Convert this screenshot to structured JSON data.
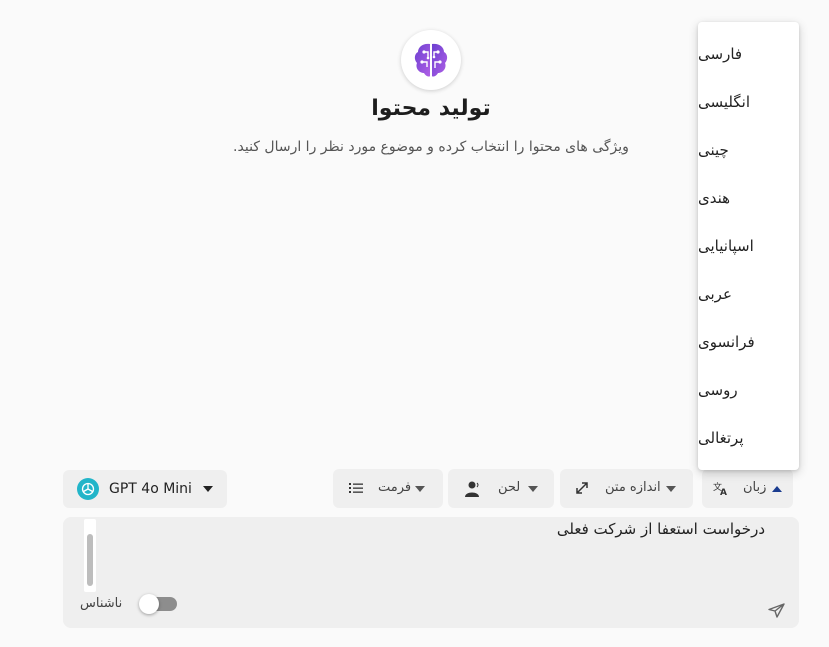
{
  "header": {
    "title": "تولید محتوا",
    "subtitle": "ویژگی های محتوا را انتخاب کرده و موضوع مورد نظر را ارسال کنید."
  },
  "toolbar": {
    "language_label": "زبان",
    "size_label": "اندازه متن",
    "tone_label": "لحن",
    "format_label": "فرمت",
    "model_label": "GPT 4o Mini"
  },
  "input": {
    "value": "درخواست استعفا از شرکت فعلی",
    "anonymous_label": "ناشناس",
    "anonymous_on": false
  },
  "language_menu": {
    "items": [
      "فارسی",
      "انگلیسی",
      "چینی",
      "هندی",
      "اسپانیایی",
      "عربی",
      "فرانسوی",
      "روسی",
      "پرتغالی"
    ]
  },
  "colors": {
    "logo_purple": "#8a4fd8",
    "model_icon": "#22b5c9",
    "language_accent": "#1a3c8f"
  },
  "icons": {
    "logo": "brain-circuit-icon",
    "language": "translate-icon",
    "size": "expand-icon",
    "tone": "voice-person-icon",
    "format": "list-icon",
    "model": "openai-icon",
    "send": "send-icon"
  }
}
